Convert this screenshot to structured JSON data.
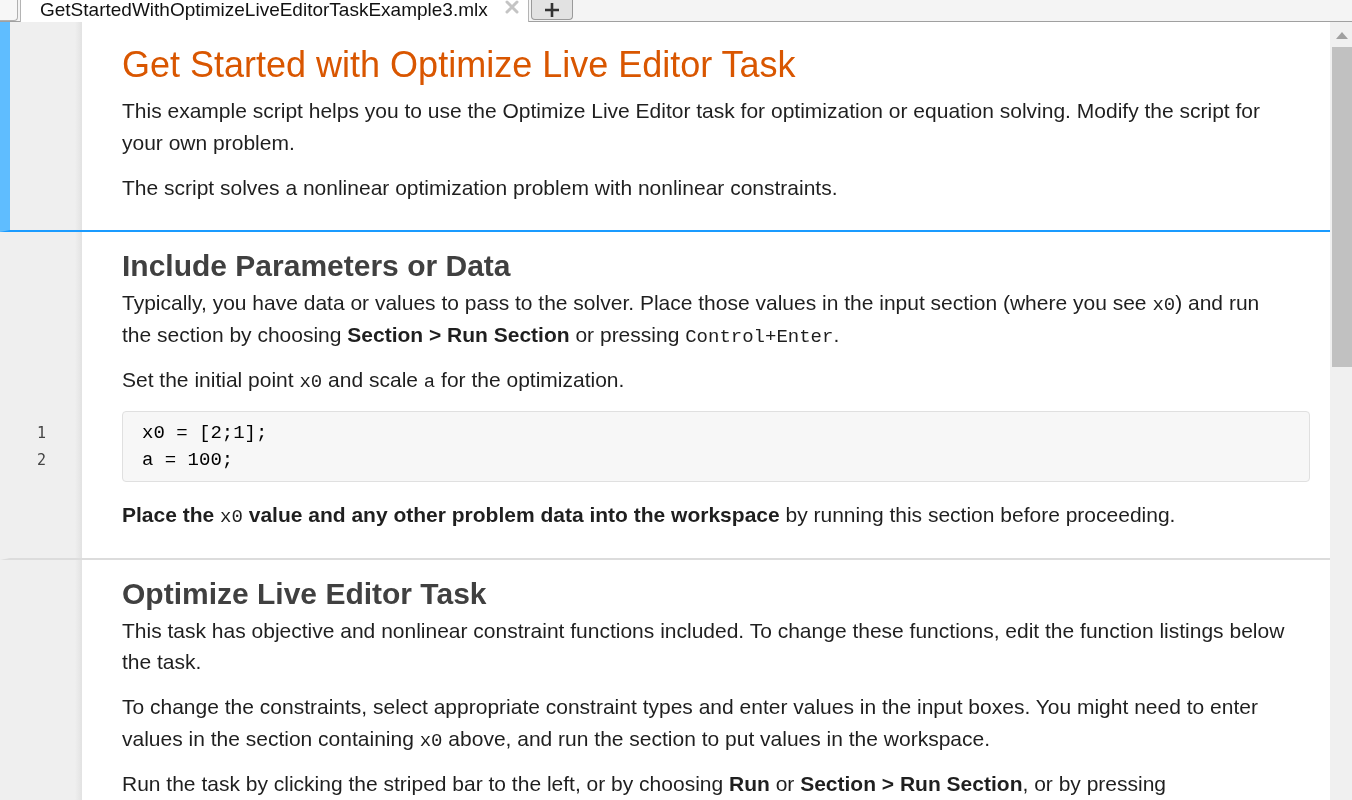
{
  "tabs": [
    {
      "label": "GetStartedWithOptimizeLiveEditorTaskExample3.mlx",
      "selected": true
    }
  ],
  "sections": [
    {
      "selected": true,
      "blocks": [
        {
          "kind": "title",
          "text": "Get Started with Optimize Live Editor Task"
        },
        {
          "kind": "paragraph",
          "runs": [
            {
              "kind": "text",
              "text": "This example script helps you to use the Optimize Live Editor task for optimization or equation solving. Modify the script for your own problem."
            }
          ]
        },
        {
          "kind": "paragraph",
          "runs": [
            {
              "kind": "text",
              "text": "The script solves a nonlinear optimization problem with nonlinear constraints."
            }
          ]
        }
      ]
    },
    {
      "selected": false,
      "blocks": [
        {
          "kind": "heading",
          "text": "Include Parameters or Data"
        },
        {
          "kind": "paragraph",
          "runs": [
            {
              "kind": "text",
              "text": "Typically, you have data or values to pass to the solver. Place those values in the input section (where you see "
            },
            {
              "kind": "code",
              "text": "x0"
            },
            {
              "kind": "text",
              "text": ") and run the section by choosing "
            },
            {
              "kind": "bold",
              "text": "Section > Run Section"
            },
            {
              "kind": "text",
              "text": " or pressing "
            },
            {
              "kind": "code",
              "text": "Control+Enter"
            },
            {
              "kind": "text",
              "text": "."
            }
          ]
        },
        {
          "kind": "paragraph",
          "runs": [
            {
              "kind": "text",
              "text": "Set the initial point "
            },
            {
              "kind": "code",
              "text": "x0"
            },
            {
              "kind": "text",
              "text": " and scale "
            },
            {
              "kind": "code",
              "text": "a"
            },
            {
              "kind": "text",
              "text": " for the optimization."
            }
          ]
        },
        {
          "kind": "code",
          "lines": [
            {
              "number": "1",
              "code": "x0 = [2;1];"
            },
            {
              "number": "2",
              "code": "a = 100;"
            }
          ]
        },
        {
          "kind": "paragraph",
          "runs": [
            {
              "kind": "bold",
              "text": "Place the "
            },
            {
              "kind": "code",
              "text": "x0"
            },
            {
              "kind": "bold",
              "text": " value and any other problem data into the workspace"
            },
            {
              "kind": "text",
              "text": " by running this section before proceeding."
            }
          ]
        }
      ]
    },
    {
      "selected": false,
      "blocks": [
        {
          "kind": "heading",
          "text": "Optimize Live Editor Task"
        },
        {
          "kind": "paragraph",
          "runs": [
            {
              "kind": "text",
              "text": "This task has objective and nonlinear constraint functions included. To change these functions, edit the function listings below the task."
            }
          ]
        },
        {
          "kind": "paragraph",
          "runs": [
            {
              "kind": "text",
              "text": "To change the constraints, select appropriate constraint types and enter values in the input boxes. You might need to enter values in the section containing "
            },
            {
              "kind": "code",
              "text": "x0"
            },
            {
              "kind": "text",
              "text": " above, and run the section to put values in the workspace."
            }
          ]
        },
        {
          "kind": "paragraph",
          "runs": [
            {
              "kind": "text",
              "text": "Run the task by clicking the striped bar to the left, or by choosing "
            },
            {
              "kind": "bold",
              "text": "Run"
            },
            {
              "kind": "text",
              "text": " or "
            },
            {
              "kind": "bold",
              "text": "Section > Run Section"
            },
            {
              "kind": "text",
              "text": ", or by pressing"
            }
          ]
        }
      ]
    }
  ]
}
